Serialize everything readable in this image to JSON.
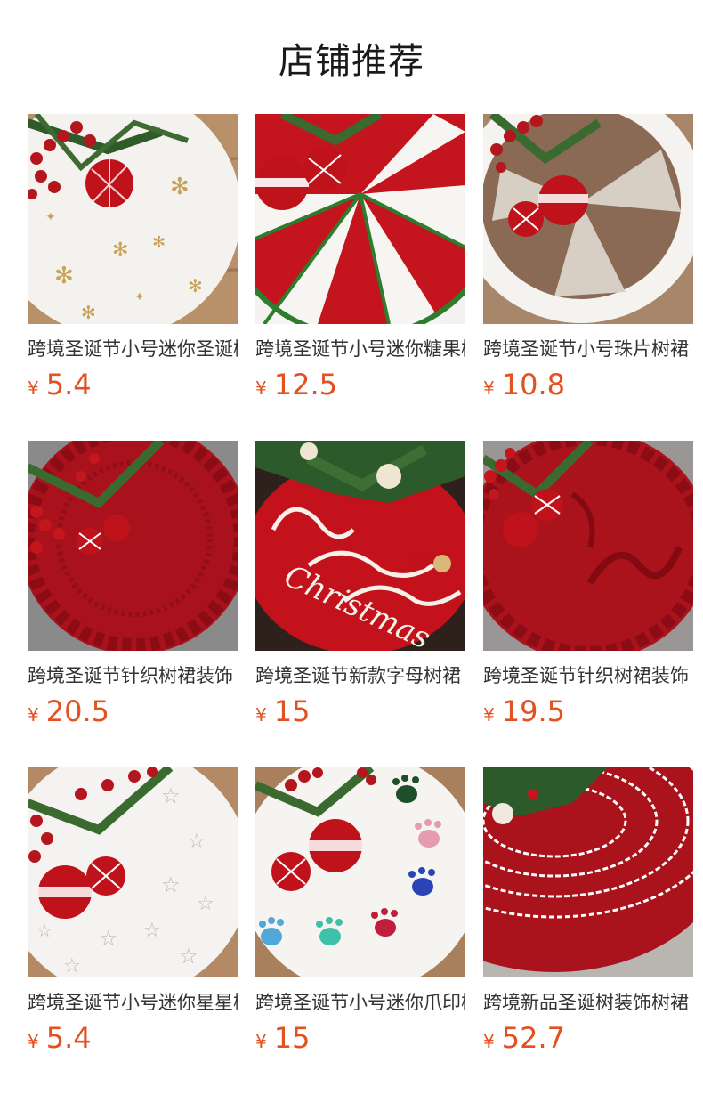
{
  "header": {
    "title": "店铺推荐"
  },
  "currency": "¥",
  "products": [
    {
      "name": "跨境圣诞节小号迷你圣诞树裙",
      "price": "5.4",
      "image": "white-snowflake-tree-skirt"
    },
    {
      "name": "跨境圣诞节小号迷你糖果树裙",
      "price": "12.5",
      "image": "red-white-swirl-tree-skirt"
    },
    {
      "name": "跨境圣诞节小号珠片树裙",
      "price": "10.8",
      "image": "sequin-tree-skirt"
    },
    {
      "name": "跨境圣诞节针织树裙装饰",
      "price": "20.5",
      "image": "red-knit-tree-skirt"
    },
    {
      "name": "跨境圣诞节新款字母树裙",
      "price": "15",
      "image": "merry-christmas-tree-skirt"
    },
    {
      "name": "跨境圣诞节针织树裙装饰",
      "price": "19.5",
      "image": "red-knit-bow-tree-skirt"
    },
    {
      "name": "跨境圣诞节小号迷你星星树裙",
      "price": "5.4",
      "image": "white-star-tree-skirt"
    },
    {
      "name": "跨境圣诞节小号迷你爪印树裙",
      "price": "15",
      "image": "paw-print-tree-skirt"
    },
    {
      "name": "跨境新品圣诞树装饰树裙",
      "price": "52.7",
      "image": "red-stripe-knit-tree-skirt"
    }
  ]
}
